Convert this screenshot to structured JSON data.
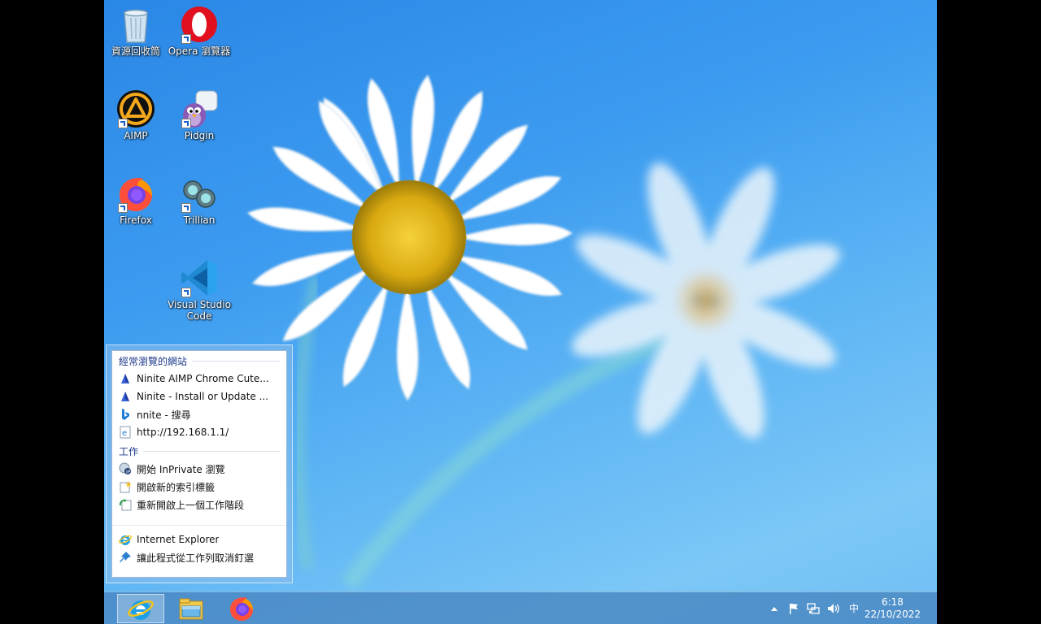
{
  "desktop": {
    "icons": [
      {
        "label": "資源回收筒",
        "icon": "recycle-bin-icon"
      },
      {
        "label": "Opera 瀏覽器",
        "icon": "opera-icon"
      },
      {
        "label": "AIMP",
        "icon": "aimp-icon"
      },
      {
        "label": "Pidgin",
        "icon": "pidgin-icon"
      },
      {
        "label": "Firefox",
        "icon": "firefox-icon"
      },
      {
        "label": "Trillian",
        "icon": "trillian-icon"
      },
      {
        "label": "Visual Studio Code",
        "icon": "vscode-icon"
      }
    ]
  },
  "jumplist": {
    "frequent_header": "經常瀏覽的網站",
    "frequent": [
      {
        "label": "Ninite AIMP Chrome Cute...",
        "icon": "ninite-icon"
      },
      {
        "label": "Ninite - Install or Update ...",
        "icon": "ninite-icon"
      },
      {
        "label": "nnite - 搜尋",
        "icon": "bing-icon"
      },
      {
        "label": "http://192.168.1.1/",
        "icon": "ie-page-icon"
      }
    ],
    "tasks_header": "工作",
    "tasks": [
      {
        "label": "開始 InPrivate 瀏覽",
        "icon": "inprivate-icon"
      },
      {
        "label": "開啟新的索引標籤",
        "icon": "new-tab-icon"
      },
      {
        "label": "重新開啟上一個工作階段",
        "icon": "reopen-session-icon"
      }
    ],
    "app_items": [
      {
        "label": "Internet Explorer",
        "icon": "internet-explorer-icon"
      },
      {
        "label": "讓此程式從工作列取消釘選",
        "icon": "unpin-icon"
      }
    ]
  },
  "taskbar": {
    "pinned": [
      {
        "name": "Internet Explorer",
        "icon": "internet-explorer-icon",
        "active": true
      },
      {
        "name": "File Explorer",
        "icon": "file-explorer-icon",
        "active": false
      },
      {
        "name": "Firefox",
        "icon": "firefox-icon",
        "active": false
      }
    ],
    "tray": {
      "ime": "中",
      "time": "6:18",
      "date": "22/10/2022"
    }
  }
}
